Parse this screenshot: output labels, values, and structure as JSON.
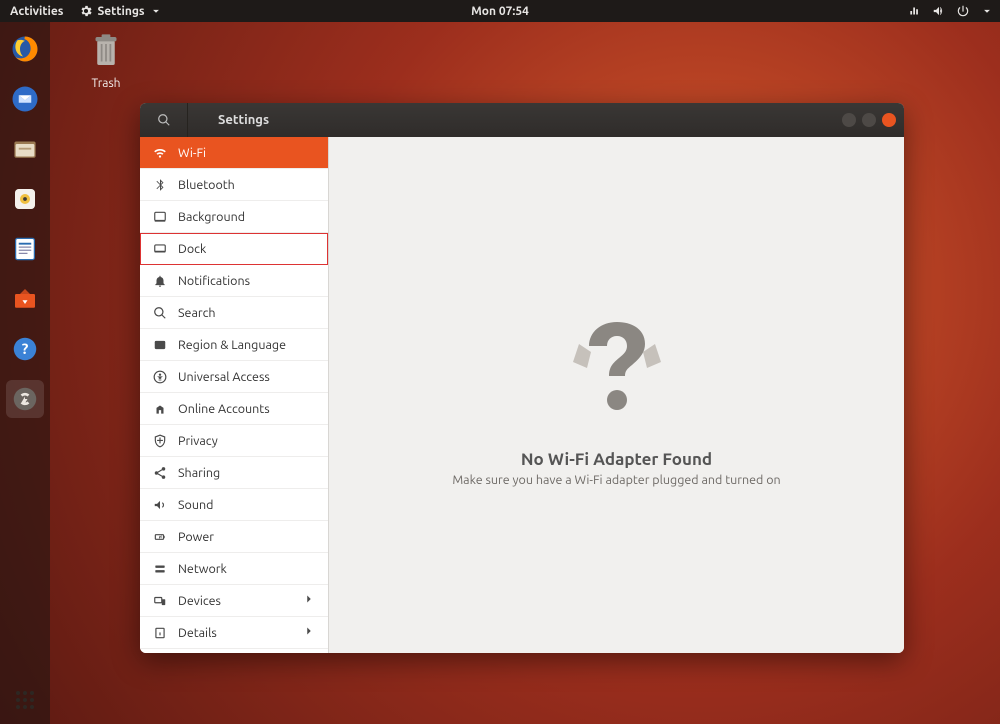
{
  "top_panel": {
    "activities": "Activities",
    "app_menu": "Settings",
    "clock": "Mon 07:54"
  },
  "desktop": {
    "trash_label": "Trash"
  },
  "window": {
    "title": "Settings"
  },
  "sidebar": {
    "items": [
      {
        "label": "Wi-Fi"
      },
      {
        "label": "Bluetooth"
      },
      {
        "label": "Background"
      },
      {
        "label": "Dock"
      },
      {
        "label": "Notifications"
      },
      {
        "label": "Search"
      },
      {
        "label": "Region & Language"
      },
      {
        "label": "Universal Access"
      },
      {
        "label": "Online Accounts"
      },
      {
        "label": "Privacy"
      },
      {
        "label": "Sharing"
      },
      {
        "label": "Sound"
      },
      {
        "label": "Power"
      },
      {
        "label": "Network"
      },
      {
        "label": "Devices"
      },
      {
        "label": "Details"
      }
    ]
  },
  "content": {
    "headline": "No Wi-Fi Adapter Found",
    "sub": "Make sure you have a Wi-Fi adapter plugged and turned on"
  }
}
